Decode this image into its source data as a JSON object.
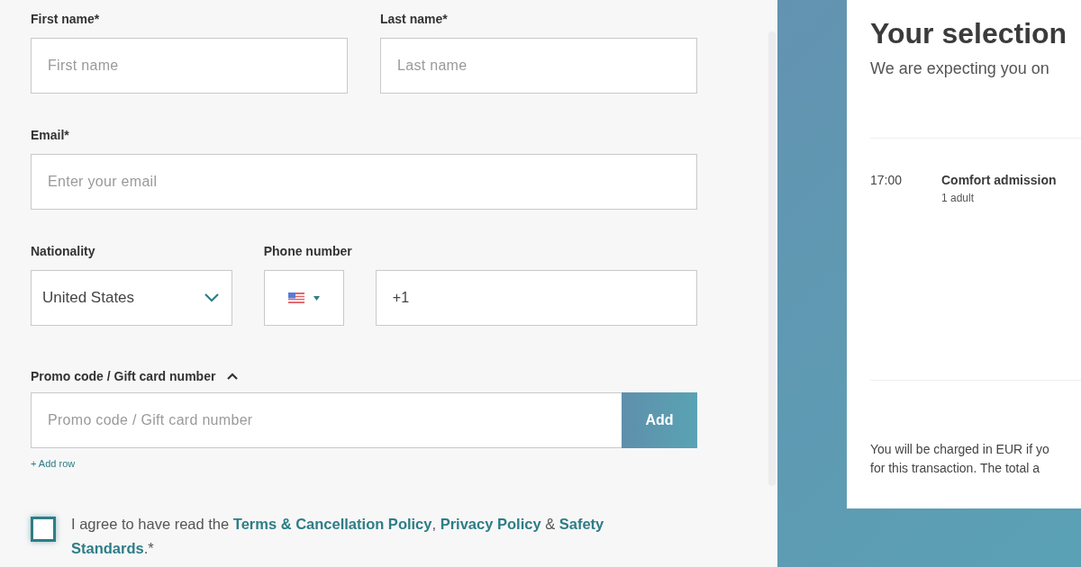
{
  "form": {
    "name_fields": [
      {
        "label": "First name*",
        "placeholder": "First name"
      },
      {
        "label": "Last name*",
        "placeholder": "Last name"
      }
    ],
    "email": {
      "label": "Email*",
      "placeholder": "Enter your email"
    },
    "nationality": {
      "label": "Nationality",
      "value": "United States"
    },
    "phone": {
      "label": "Phone number",
      "value": "+1"
    },
    "promo": {
      "label": "Promo code / Gift card number",
      "expanded": true,
      "placeholder": "Promo code / Gift card number",
      "button": "Add",
      "add_row": "+ Add row"
    },
    "agreement": {
      "checked": false,
      "parts": [
        {
          "kind": "text",
          "text": "I agree to have read the "
        },
        {
          "kind": "link",
          "text": "Terms & Cancellation Policy"
        },
        {
          "kind": "text",
          "text": ", "
        },
        {
          "kind": "link",
          "text": "Privacy Policy"
        },
        {
          "kind": "text",
          "text": " & "
        },
        {
          "kind": "link",
          "text": "Safety"
        },
        {
          "kind": "space"
        },
        {
          "kind": "link",
          "text": "Standards"
        },
        {
          "kind": "text",
          "text": ".*"
        }
      ]
    }
  },
  "selection": {
    "title": "Your selection",
    "subtitle": "We are expecting you on",
    "items": [
      {
        "time": "17:00",
        "name": "Comfort admission",
        "detail": "1 adult"
      }
    ],
    "note_lines": [
      "You will be charged in EUR if yo",
      "for this transaction. The total a"
    ]
  }
}
